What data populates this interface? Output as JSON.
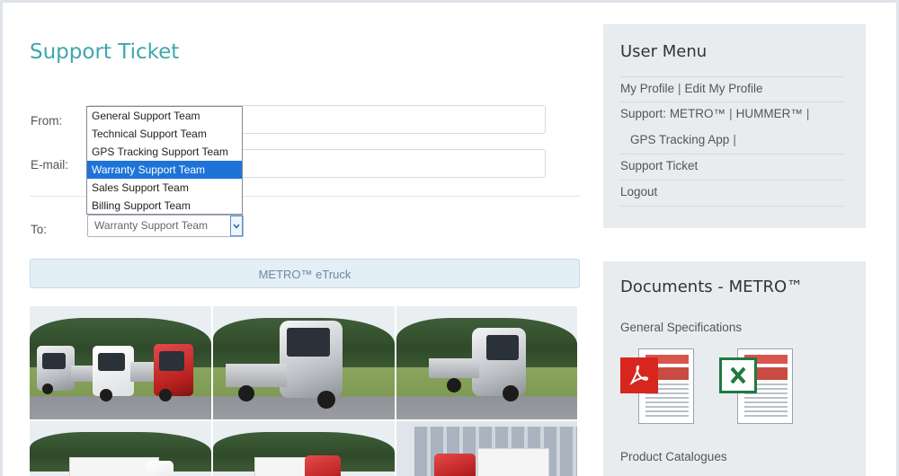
{
  "page": {
    "title": "Support Ticket"
  },
  "form": {
    "from_label": "From:",
    "email_label": "E-mail:",
    "to_label": "To:",
    "from_value": "",
    "email_value": "",
    "to_selected": "Warranty Support Team",
    "to_options": [
      "General Support Team",
      "Technical Support Team",
      "GPS Tracking Support Team",
      "Warranty Support Team",
      "Sales Support Team",
      "Billing Support Team"
    ],
    "highlighted_option_index": 3
  },
  "banner": {
    "label": "METRO™ eTruck"
  },
  "user_menu": {
    "title": "User Menu",
    "my_profile": "My Profile",
    "edit_profile": "Edit My Profile",
    "support_label": "Support:",
    "metro": "METRO™",
    "hummer": "HUMMER™",
    "gps_app": "GPS Tracking App",
    "support_ticket": "Support Ticket",
    "logout": "Logout",
    "separator": "|"
  },
  "documents": {
    "title": "Documents - METRO™",
    "general_specs": "General Specifications",
    "product_catalogues": "Product Catalogues",
    "pdf_icon": "pdf-file-icon",
    "excel_icon": "excel-file-icon"
  },
  "colors": {
    "title": "#3fa6ad",
    "highlight": "#1e73d8",
    "sidebar_bg": "#e8ecef",
    "banner_bg": "#e3eef5",
    "pdf_red": "#d7261d",
    "excel_green": "#1e7a3e"
  }
}
